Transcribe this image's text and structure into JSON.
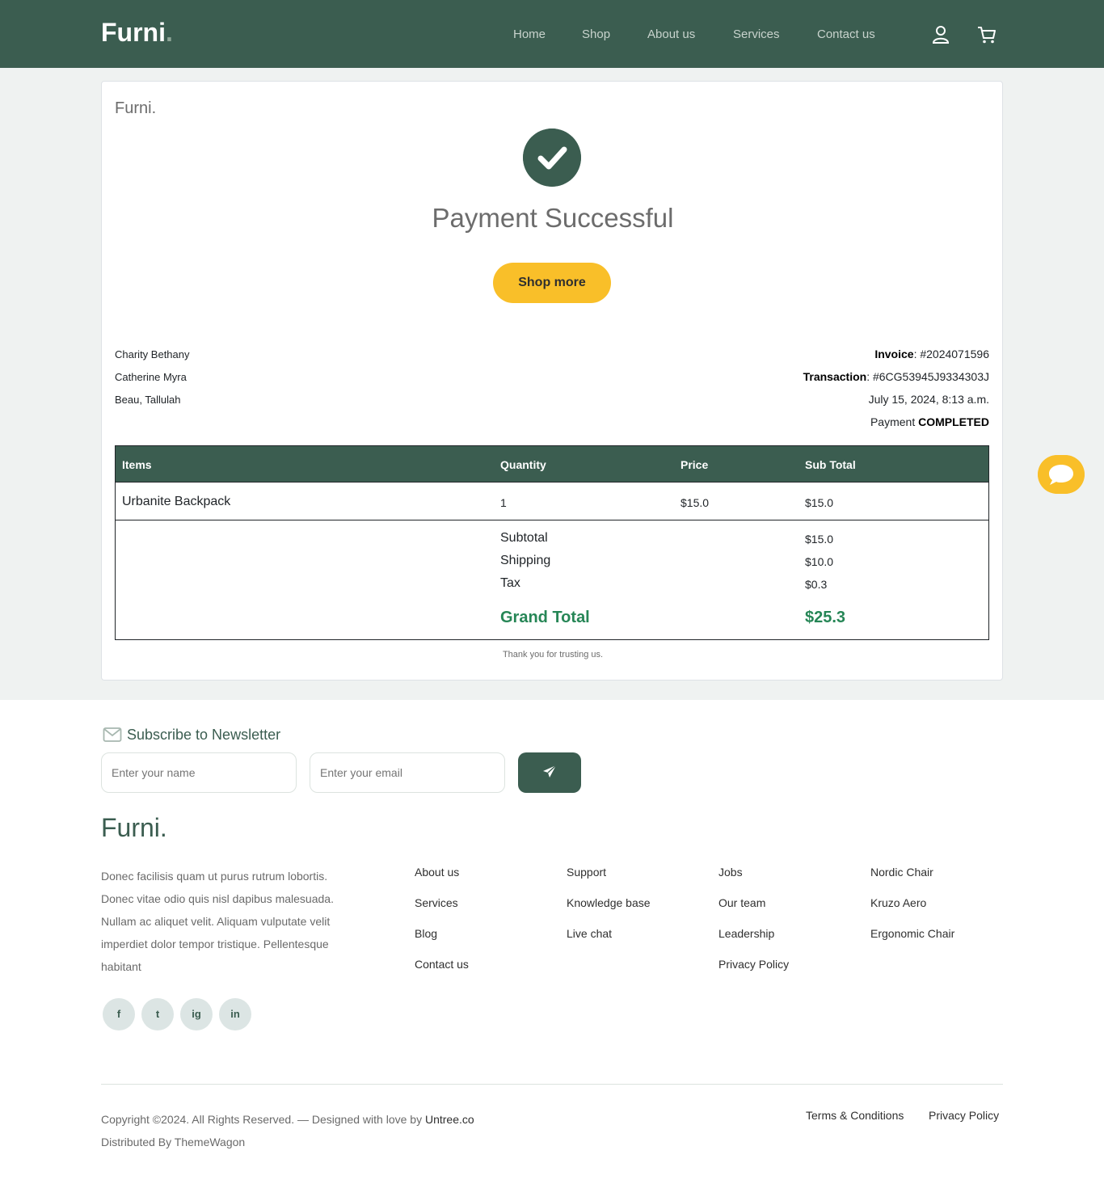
{
  "header": {
    "brand": "Furni",
    "brand_dot": ".",
    "nav": [
      "Home",
      "Shop",
      "About us",
      "Services",
      "Contact us"
    ]
  },
  "receipt": {
    "logo": "Furni.",
    "title": "Payment Successful",
    "shop_more": "Shop more",
    "address": [
      "Charity Bethany",
      "Catherine Myra",
      "Beau, Tallulah"
    ],
    "invoice_label": "Invoice",
    "invoice_value": ": #2024071596",
    "transaction_label": "Transaction",
    "transaction_value": ": #6CG53945J9334303J",
    "date": "July 15, 2024, 8:13 a.m.",
    "payment_label": "Payment ",
    "payment_status": "COMPLETED",
    "table": {
      "headers": [
        "Items",
        "Quantity",
        "Price",
        "Sub Total"
      ],
      "row": {
        "item": "Urbanite Backpack",
        "qty": "1",
        "price": "$15.0",
        "subtotal": "$15.0"
      },
      "subtotal_label": "Subtotal",
      "subtotal_value": "$15.0",
      "shipping_label": "Shipping",
      "shipping_value": "$10.0",
      "tax_label": "Tax",
      "tax_value": "$0.3",
      "grand_label": "Grand Total",
      "grand_value": "$25.3"
    },
    "thanks": "Thank you for trusting us."
  },
  "footer": {
    "newsletter_title": "Subscribe to Newsletter",
    "name_placeholder": "Enter your name",
    "email_placeholder": "Enter your email",
    "logo": "Furni.",
    "description": "Donec facilisis quam ut purus rutrum lobortis. Donec vitae odio quis nisl dapibus malesuada. Nullam ac aliquet velit. Aliquam vulputate velit imperdiet dolor tempor tristique. Pellentesque habitant",
    "social": [
      "f",
      "t",
      "ig",
      "in"
    ],
    "col1": [
      "About us",
      "Services",
      "Blog",
      "Contact us"
    ],
    "col2": [
      "Support",
      "Knowledge base",
      "Live chat"
    ],
    "col3": [
      "Jobs",
      "Our team",
      "Leadership",
      "Privacy Policy"
    ],
    "col4": [
      "Nordic Chair",
      "Kruzo Aero",
      "Ergonomic Chair"
    ],
    "copyright": "Copyright ©2024. All Rights Reserved. — Designed with love by ",
    "copyright_link": "Untree.co",
    "distributed": "Distributed By ThemeWagon",
    "terms": "Terms & Conditions",
    "privacy": "Privacy Policy"
  },
  "colors": {
    "primary": "#3b5d50",
    "accent": "#f9bf29",
    "grand_total": "#268656"
  },
  "icons": [
    "user-icon",
    "cart-icon",
    "check-icon",
    "chat-icon",
    "envelope-icon",
    "paper-plane-icon",
    "facebook-icon",
    "twitter-icon",
    "instagram-icon",
    "linkedin-icon"
  ]
}
